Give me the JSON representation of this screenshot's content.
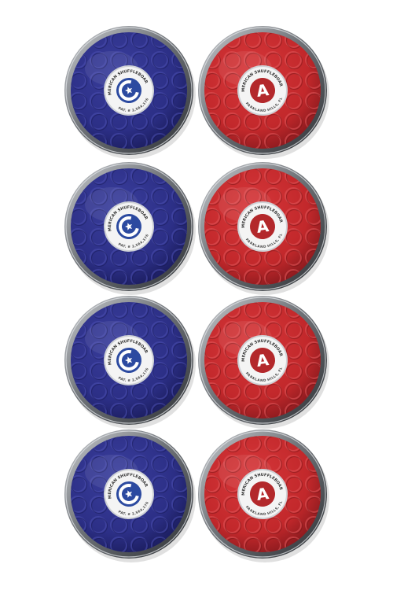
{
  "image": {
    "subject": "shuffleboard-pucks",
    "background_color": "#ffffff"
  },
  "colors": {
    "blue_puck": "#2c2f86",
    "blue_puck_dark": "#1e216a",
    "red_puck": "#c2282b",
    "red_puck_dark": "#8f1b1f",
    "chrome_rim": "#8d9196",
    "cap_white": "#f4f4f4",
    "cap_blue": "#2c4aa0",
    "cap_red": "#b3282b"
  },
  "icons": {
    "blue_cap_icon": "c-star-icon",
    "red_cap_icon": "letter-a-icon"
  },
  "cap_text": {
    "brand": "AMERICAN SHUFFLEBOARD",
    "blue_bottom": "PAT. # 2,564,176",
    "red_bottom": "PARKLAND HILLS, FL",
    "blue_letter": "C",
    "red_letter": "A"
  },
  "pucks": {
    "blue_count": 4,
    "red_count": 4
  }
}
